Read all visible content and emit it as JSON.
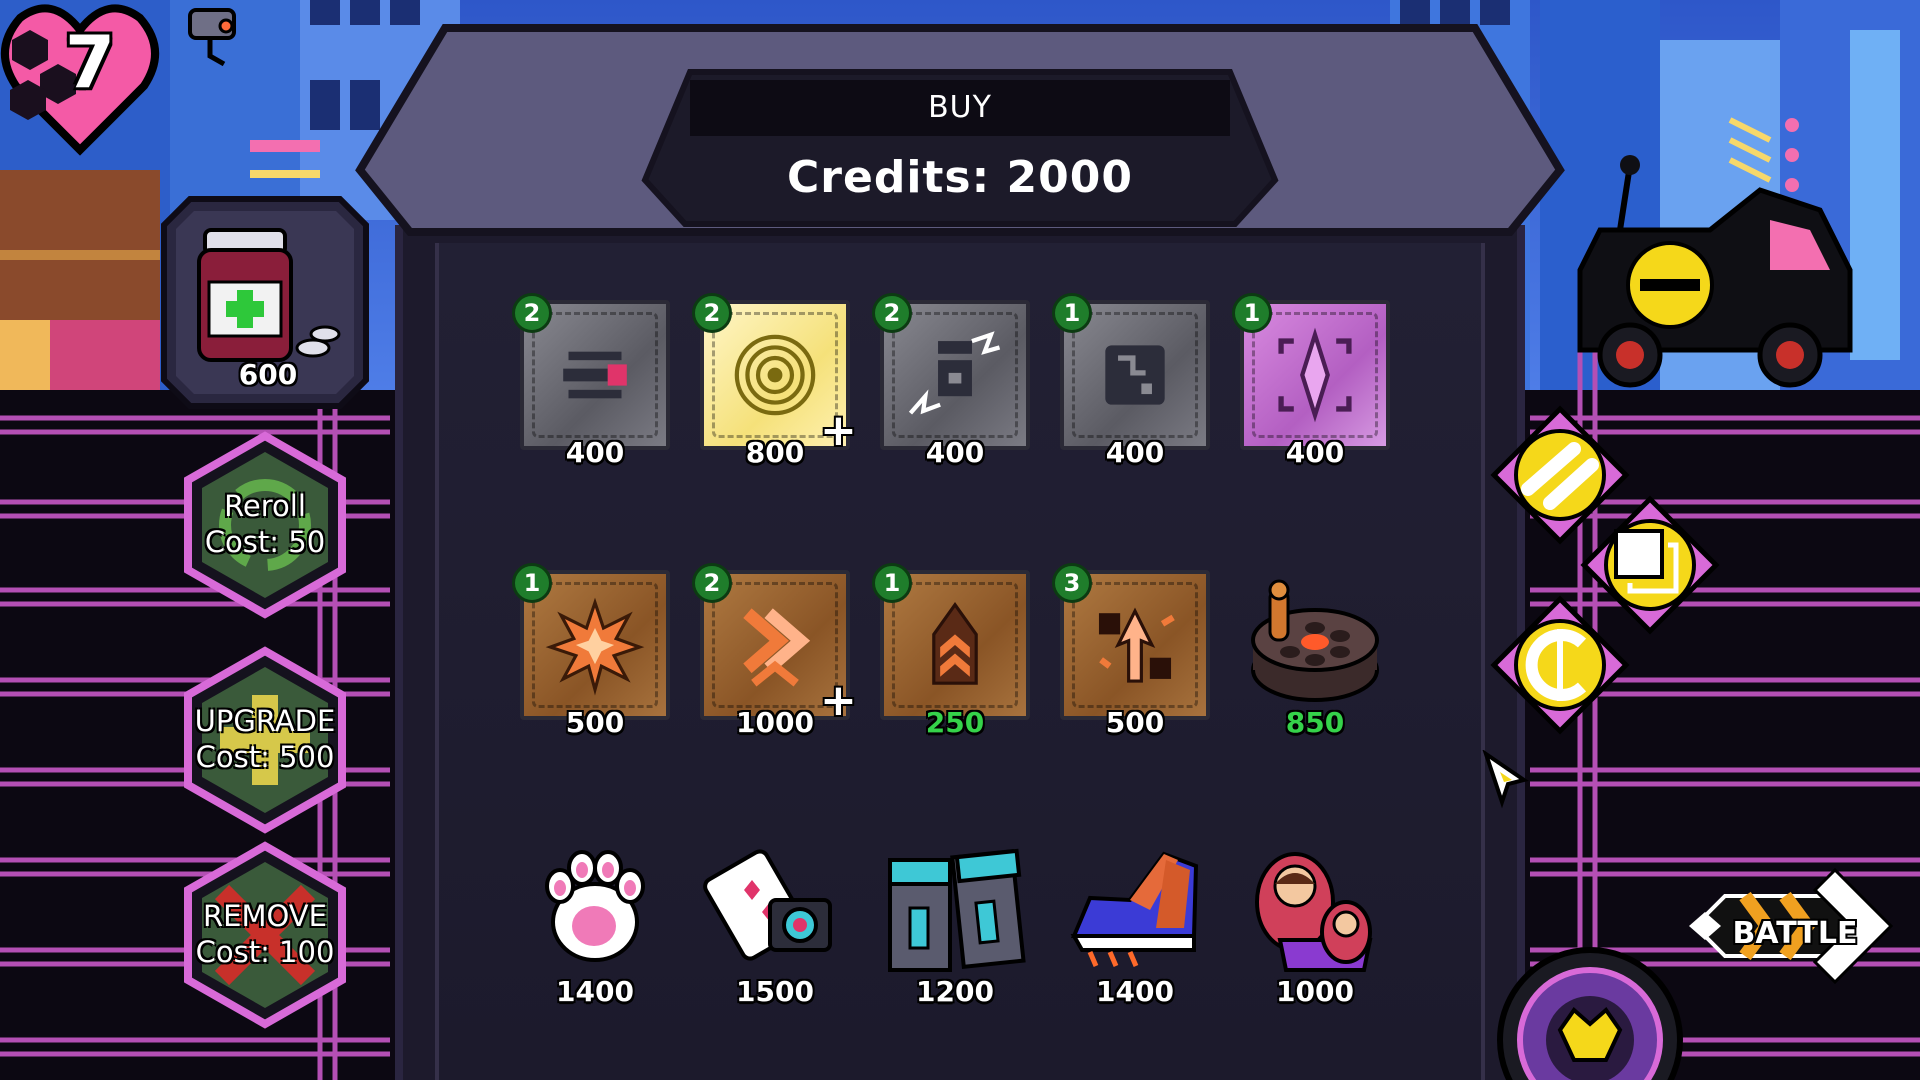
{
  "hud": {
    "lives": "7",
    "potion_price": "600"
  },
  "shop": {
    "title": "BUY",
    "credits": "Credits: 2000"
  },
  "cards_row1": [
    {
      "badge": "2",
      "price": "400",
      "rarity": "grey",
      "icon": "stacked-bars-icon",
      "upgrade": false
    },
    {
      "badge": "2",
      "price": "800",
      "rarity": "gold",
      "icon": "concentric-rings-icon",
      "upgrade": true
    },
    {
      "badge": "2",
      "price": "400",
      "rarity": "grey",
      "icon": "lightning-robot-icon",
      "upgrade": false
    },
    {
      "badge": "1",
      "price": "400",
      "rarity": "grey",
      "icon": "circuit-square-icon",
      "upgrade": false
    },
    {
      "badge": "1",
      "price": "400",
      "rarity": "pink",
      "icon": "crystal-target-icon",
      "upgrade": false
    }
  ],
  "cards_row2": [
    {
      "badge": "1",
      "price": "500",
      "rarity": "bronze",
      "icon": "explosion-icon",
      "upgrade": false,
      "affordable_highlight": false
    },
    {
      "badge": "2",
      "price": "1000",
      "rarity": "bronze",
      "icon": "double-chevron-icon",
      "upgrade": true,
      "affordable_highlight": false
    },
    {
      "badge": "1",
      "price": "250",
      "rarity": "bronze",
      "icon": "rank-chevron-icon",
      "upgrade": false,
      "affordable_highlight": true
    }
  ],
  "card_row2_extra": {
    "badge": "3",
    "price": "500",
    "rarity": "bronze",
    "icon": "arrow-burst-icon"
  },
  "item_revolver": {
    "price": "850",
    "icon": "revolver-cylinder-icon"
  },
  "relics": [
    {
      "price": "1400",
      "icon": "paw-icon"
    },
    {
      "price": "1500",
      "icon": "card-camera-icon"
    },
    {
      "price": "1200",
      "icon": "battery-pack-icon"
    },
    {
      "price": "1400",
      "icon": "sneaker-icon"
    },
    {
      "price": "1000",
      "icon": "nesting-doll-icon"
    }
  ],
  "side_buttons": {
    "reroll": {
      "line1": "Reroll",
      "line2": "Cost: 50"
    },
    "upgrade": {
      "line1": "UPGRADE",
      "line2": "Cost: 500"
    },
    "remove": {
      "line1": "REMOVE",
      "line2": "Cost: 100"
    }
  },
  "battle": {
    "label": "BATTLE"
  },
  "colors": {
    "accent_pink": "#d86ad8",
    "credit_green": "#35d24a",
    "badge_green": "#1f7d2b",
    "yellow": "#f5d81a"
  }
}
